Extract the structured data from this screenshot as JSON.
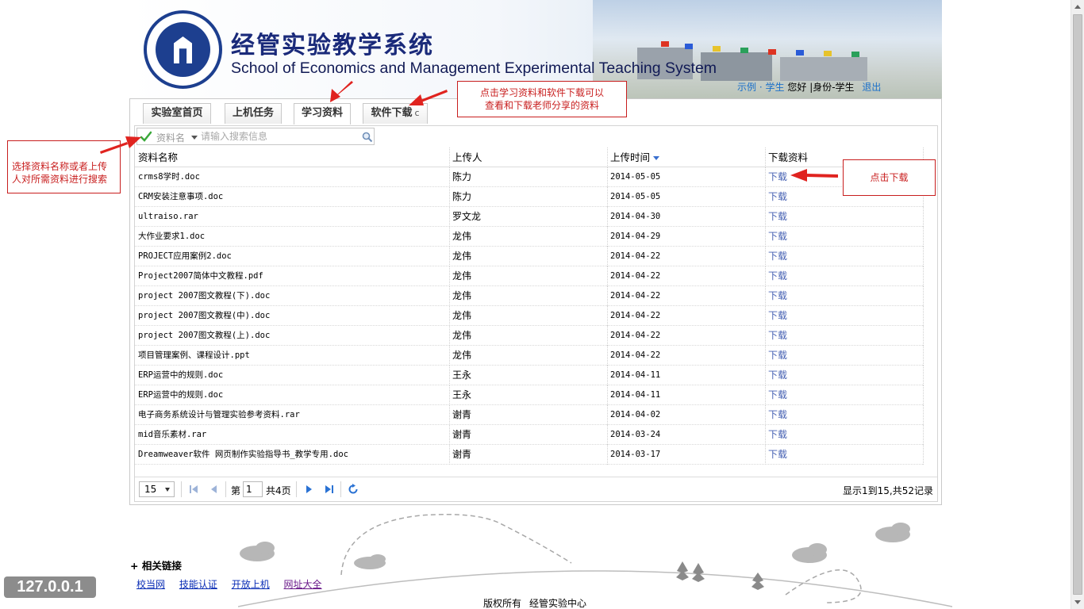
{
  "header": {
    "title_cn": "经管实验教学系统",
    "title_en": "School of Economics and Management Experimental Teaching System",
    "user_name": "示例",
    "user_dot": "·",
    "user_role_link": "学生",
    "greeting": "您好",
    "identity": "|身份-学生",
    "logout": "退出"
  },
  "tabs": [
    {
      "label": "实验室首页"
    },
    {
      "label": "上机任务"
    },
    {
      "label": "学习资料",
      "active": true
    },
    {
      "label": "软件下载",
      "icon": "refresh-icon"
    }
  ],
  "tab_refresh_glyph": "c",
  "search": {
    "field_label": "资料名",
    "placeholder": "请输入搜索信息",
    "icon": "search-icon"
  },
  "table": {
    "columns": [
      "资料名称",
      "上传人",
      "上传时间",
      "下载资料"
    ],
    "sorted_column": "上传时间",
    "sort_direction": "desc",
    "rows": [
      {
        "name": "crms8学时.doc",
        "uploader": "陈力",
        "date": "2014-05-05",
        "action": "下载"
      },
      {
        "name": "CRM安装注意事项.doc",
        "uploader": "陈力",
        "date": "2014-05-05",
        "action": "下载"
      },
      {
        "name": "ultraiso.rar",
        "uploader": "罗文龙",
        "date": "2014-04-30",
        "action": "下载"
      },
      {
        "name": "大作业要求1.doc",
        "uploader": "龙伟",
        "date": "2014-04-29",
        "action": "下载"
      },
      {
        "name": "PROJECT应用案例2.doc",
        "uploader": "龙伟",
        "date": "2014-04-22",
        "action": "下载"
      },
      {
        "name": "Project2007简体中文教程.pdf",
        "uploader": "龙伟",
        "date": "2014-04-22",
        "action": "下载"
      },
      {
        "name": "project 2007图文教程(下).doc",
        "uploader": "龙伟",
        "date": "2014-04-22",
        "action": "下载"
      },
      {
        "name": "project 2007图文教程(中).doc",
        "uploader": "龙伟",
        "date": "2014-04-22",
        "action": "下载"
      },
      {
        "name": "project 2007图文教程(上).doc",
        "uploader": "龙伟",
        "date": "2014-04-22",
        "action": "下载"
      },
      {
        "name": "项目管理案例、课程设计.ppt",
        "uploader": "龙伟",
        "date": "2014-04-22",
        "action": "下载"
      },
      {
        "name": "ERP运营中的规则.doc",
        "uploader": "王永",
        "date": "2014-04-11",
        "action": "下载"
      },
      {
        "name": "ERP运营中的规则.doc",
        "uploader": "王永",
        "date": "2014-04-11",
        "action": "下载"
      },
      {
        "name": "电子商务系统设计与管理实验参考资料.rar",
        "uploader": "谢青",
        "date": "2014-04-02",
        "action": "下载"
      },
      {
        "name": "mid音乐素材.rar",
        "uploader": "谢青",
        "date": "2014-03-24",
        "action": "下载"
      },
      {
        "name": "Dreamweaver软件 网页制作实验指导书_教学专用.doc",
        "uploader": "谢青",
        "date": "2014-03-17",
        "action": "下载"
      }
    ]
  },
  "pager": {
    "page_size": "15",
    "page_prefix": "第",
    "current_page": "1",
    "total_pages": "共4页",
    "summary": "显示1到15,共52记录"
  },
  "annotations": {
    "tabs_note_line1": "点击学习资料和软件下载可以",
    "tabs_note_line2": "查看和下载老师分享的资料",
    "search_note_line1": "选择资料名称或者上传",
    "search_note_line2": "人对所需资料进行搜索",
    "download_note": "点击下载",
    "color": "#c81e1e"
  },
  "footer": {
    "links_title": "+ 相关链接",
    "links": [
      "校当网",
      "技能认证",
      "开放上机",
      "网址大全"
    ],
    "copyright_1": "版权所有",
    "copyright_2": "经管实验中心"
  },
  "ip_badge": "127.0.0.1",
  "colors": {
    "title": "#1a2a7a",
    "link": "#4661b3",
    "logo": "#1d3f8f"
  }
}
